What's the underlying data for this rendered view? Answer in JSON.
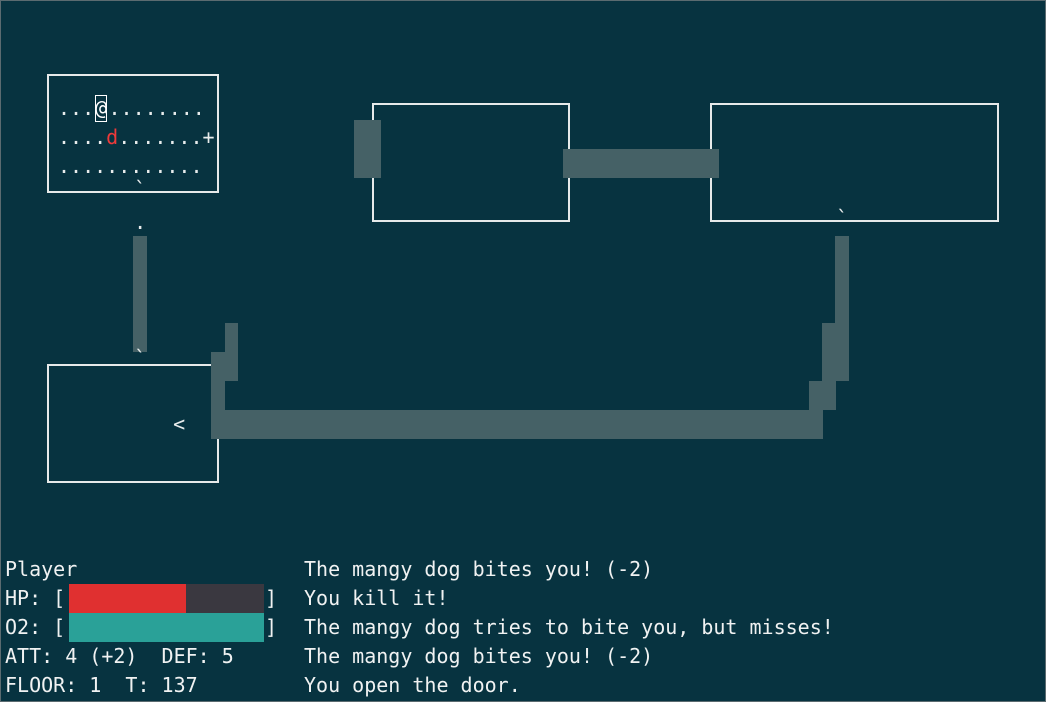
{
  "map": {
    "room_a_rows": [
      "...@........",
      "....d.......+",
      "............"
    ],
    "player_glyph": "@",
    "monster_glyph": "d",
    "door_glyph": "+",
    "doorway_glyph": "`",
    "floor_glyph": ".",
    "stairs_glyph": "<",
    "colors": {
      "background": "#073340",
      "walls": "#e6eaea",
      "corridor": "#456166",
      "monster": "#ee3a3a",
      "hp": "#e03030",
      "o2": "#2aa198"
    }
  },
  "hud": {
    "name": "Player",
    "hp_label": "HP: [",
    "hp_close": "]",
    "hp_fraction": 0.6,
    "o2_label": "O2: [",
    "o2_close": "]",
    "o2_fraction": 1.0,
    "stats": "ATT: 4 (+2)  DEF: 5",
    "floor_turn": "FLOOR: 1  T: 137"
  },
  "log": [
    "The mangy dog bites you! (-2)",
    "You kill it!",
    "The mangy dog tries to bite you, but misses!",
    "The mangy dog bites you! (-2)",
    "You open the door."
  ]
}
